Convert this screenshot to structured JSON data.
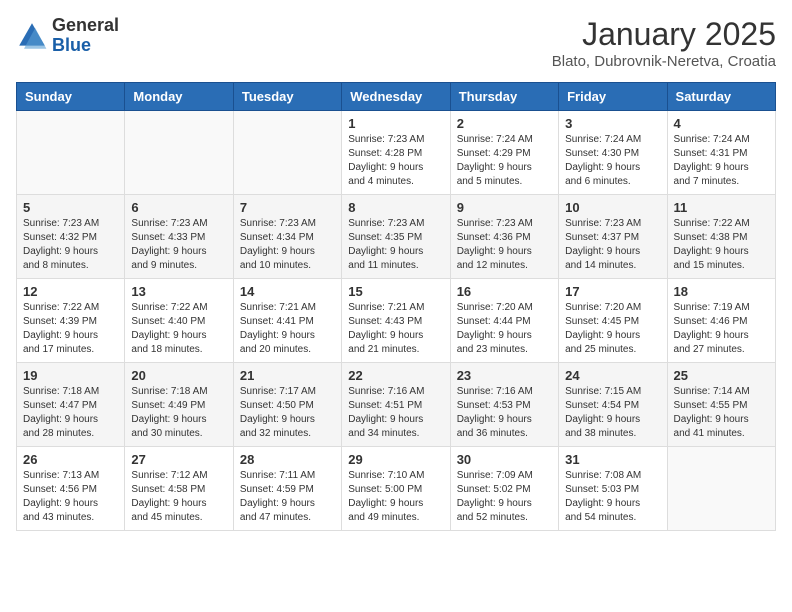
{
  "header": {
    "logo_general": "General",
    "logo_blue": "Blue",
    "month_title": "January 2025",
    "location": "Blato, Dubrovnik-Neretva, Croatia"
  },
  "weekdays": [
    "Sunday",
    "Monday",
    "Tuesday",
    "Wednesday",
    "Thursday",
    "Friday",
    "Saturday"
  ],
  "weeks": [
    [
      {
        "day": "",
        "info": ""
      },
      {
        "day": "",
        "info": ""
      },
      {
        "day": "",
        "info": ""
      },
      {
        "day": "1",
        "info": "Sunrise: 7:23 AM\nSunset: 4:28 PM\nDaylight: 9 hours\nand 4 minutes."
      },
      {
        "day": "2",
        "info": "Sunrise: 7:24 AM\nSunset: 4:29 PM\nDaylight: 9 hours\nand 5 minutes."
      },
      {
        "day": "3",
        "info": "Sunrise: 7:24 AM\nSunset: 4:30 PM\nDaylight: 9 hours\nand 6 minutes."
      },
      {
        "day": "4",
        "info": "Sunrise: 7:24 AM\nSunset: 4:31 PM\nDaylight: 9 hours\nand 7 minutes."
      }
    ],
    [
      {
        "day": "5",
        "info": "Sunrise: 7:23 AM\nSunset: 4:32 PM\nDaylight: 9 hours\nand 8 minutes."
      },
      {
        "day": "6",
        "info": "Sunrise: 7:23 AM\nSunset: 4:33 PM\nDaylight: 9 hours\nand 9 minutes."
      },
      {
        "day": "7",
        "info": "Sunrise: 7:23 AM\nSunset: 4:34 PM\nDaylight: 9 hours\nand 10 minutes."
      },
      {
        "day": "8",
        "info": "Sunrise: 7:23 AM\nSunset: 4:35 PM\nDaylight: 9 hours\nand 11 minutes."
      },
      {
        "day": "9",
        "info": "Sunrise: 7:23 AM\nSunset: 4:36 PM\nDaylight: 9 hours\nand 12 minutes."
      },
      {
        "day": "10",
        "info": "Sunrise: 7:23 AM\nSunset: 4:37 PM\nDaylight: 9 hours\nand 14 minutes."
      },
      {
        "day": "11",
        "info": "Sunrise: 7:22 AM\nSunset: 4:38 PM\nDaylight: 9 hours\nand 15 minutes."
      }
    ],
    [
      {
        "day": "12",
        "info": "Sunrise: 7:22 AM\nSunset: 4:39 PM\nDaylight: 9 hours\nand 17 minutes."
      },
      {
        "day": "13",
        "info": "Sunrise: 7:22 AM\nSunset: 4:40 PM\nDaylight: 9 hours\nand 18 minutes."
      },
      {
        "day": "14",
        "info": "Sunrise: 7:21 AM\nSunset: 4:41 PM\nDaylight: 9 hours\nand 20 minutes."
      },
      {
        "day": "15",
        "info": "Sunrise: 7:21 AM\nSunset: 4:43 PM\nDaylight: 9 hours\nand 21 minutes."
      },
      {
        "day": "16",
        "info": "Sunrise: 7:20 AM\nSunset: 4:44 PM\nDaylight: 9 hours\nand 23 minutes."
      },
      {
        "day": "17",
        "info": "Sunrise: 7:20 AM\nSunset: 4:45 PM\nDaylight: 9 hours\nand 25 minutes."
      },
      {
        "day": "18",
        "info": "Sunrise: 7:19 AM\nSunset: 4:46 PM\nDaylight: 9 hours\nand 27 minutes."
      }
    ],
    [
      {
        "day": "19",
        "info": "Sunrise: 7:18 AM\nSunset: 4:47 PM\nDaylight: 9 hours\nand 28 minutes."
      },
      {
        "day": "20",
        "info": "Sunrise: 7:18 AM\nSunset: 4:49 PM\nDaylight: 9 hours\nand 30 minutes."
      },
      {
        "day": "21",
        "info": "Sunrise: 7:17 AM\nSunset: 4:50 PM\nDaylight: 9 hours\nand 32 minutes."
      },
      {
        "day": "22",
        "info": "Sunrise: 7:16 AM\nSunset: 4:51 PM\nDaylight: 9 hours\nand 34 minutes."
      },
      {
        "day": "23",
        "info": "Sunrise: 7:16 AM\nSunset: 4:53 PM\nDaylight: 9 hours\nand 36 minutes."
      },
      {
        "day": "24",
        "info": "Sunrise: 7:15 AM\nSunset: 4:54 PM\nDaylight: 9 hours\nand 38 minutes."
      },
      {
        "day": "25",
        "info": "Sunrise: 7:14 AM\nSunset: 4:55 PM\nDaylight: 9 hours\nand 41 minutes."
      }
    ],
    [
      {
        "day": "26",
        "info": "Sunrise: 7:13 AM\nSunset: 4:56 PM\nDaylight: 9 hours\nand 43 minutes."
      },
      {
        "day": "27",
        "info": "Sunrise: 7:12 AM\nSunset: 4:58 PM\nDaylight: 9 hours\nand 45 minutes."
      },
      {
        "day": "28",
        "info": "Sunrise: 7:11 AM\nSunset: 4:59 PM\nDaylight: 9 hours\nand 47 minutes."
      },
      {
        "day": "29",
        "info": "Sunrise: 7:10 AM\nSunset: 5:00 PM\nDaylight: 9 hours\nand 49 minutes."
      },
      {
        "day": "30",
        "info": "Sunrise: 7:09 AM\nSunset: 5:02 PM\nDaylight: 9 hours\nand 52 minutes."
      },
      {
        "day": "31",
        "info": "Sunrise: 7:08 AM\nSunset: 5:03 PM\nDaylight: 9 hours\nand 54 minutes."
      },
      {
        "day": "",
        "info": ""
      }
    ]
  ]
}
